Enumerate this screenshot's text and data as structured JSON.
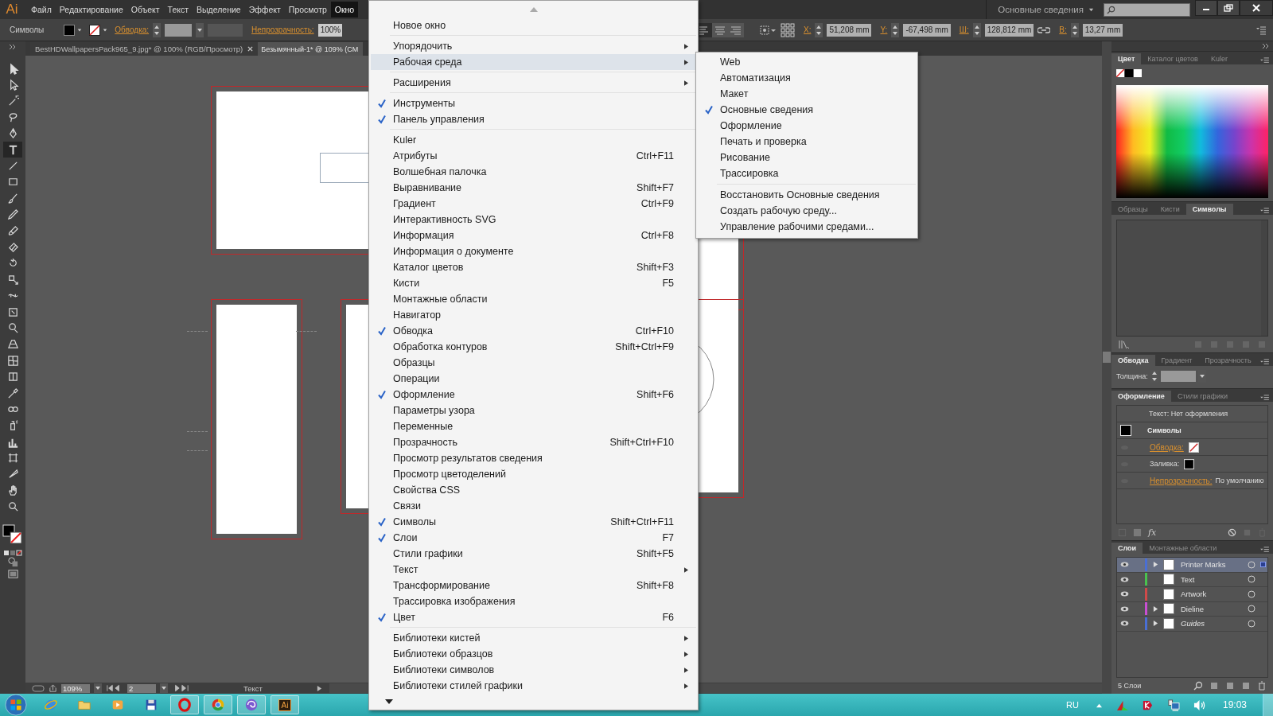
{
  "menubar": {
    "logo": "Ai",
    "items": [
      {
        "label": "Файл",
        "selected": false
      },
      {
        "label": "Редактирование",
        "selected": false
      },
      {
        "label": "Объект",
        "selected": false
      },
      {
        "label": "Текст",
        "selected": false
      },
      {
        "label": "Выделение",
        "selected": false
      },
      {
        "label": "Эффект",
        "selected": false
      },
      {
        "label": "Просмотр",
        "selected": false
      },
      {
        "label": "Окно",
        "selected": true
      }
    ],
    "workspace": "Основные сведения"
  },
  "control_bar": {
    "object": "Символы",
    "stroke_label": "Обводка:",
    "opacity_label": "Непрозрачность:",
    "opacity": "100%",
    "coords": [
      {
        "label": "X:",
        "value": "51,208 mm"
      },
      {
        "label": "Y:",
        "value": "-67,498 mm"
      },
      {
        "label": "Ш:",
        "value": "128,812 mm"
      },
      {
        "label": "В:",
        "value": "13,27 mm"
      }
    ]
  },
  "doc_tabs": [
    {
      "label": "BestHDWallpapersPack965_9.jpg* @ 100% (RGB/Просмотр)",
      "selected": false
    },
    {
      "label": "Безымянный-1* @ 109% (CM",
      "selected": true
    }
  ],
  "tools": [
    {
      "kind": "arrow",
      "selected": false
    },
    {
      "kind": "hollow-arrow",
      "selected": false
    },
    {
      "kind": "wand",
      "selected": false
    },
    {
      "kind": "lasso",
      "selected": false
    },
    {
      "kind": "pen",
      "selected": false
    },
    {
      "kind": "type",
      "selected": true
    },
    {
      "kind": "line",
      "selected": false
    },
    {
      "kind": "rectangle",
      "selected": false
    },
    {
      "kind": "brush",
      "selected": false
    },
    {
      "kind": "pencil",
      "selected": false
    },
    {
      "kind": "blob-brush",
      "selected": false
    },
    {
      "kind": "eraser",
      "selected": false
    },
    {
      "kind": "rotate",
      "selected": false
    },
    {
      "kind": "scale",
      "selected": false
    },
    {
      "kind": "width",
      "selected": false
    },
    {
      "kind": "free-transform",
      "selected": false
    },
    {
      "kind": "shape-builder",
      "selected": false
    },
    {
      "kind": "perspective-grid",
      "selected": false
    },
    {
      "kind": "mesh",
      "selected": false
    },
    {
      "kind": "gradient",
      "selected": false
    },
    {
      "kind": "eyedropper",
      "selected": false
    },
    {
      "kind": "blend",
      "selected": false
    },
    {
      "kind": "sprayer",
      "selected": false
    },
    {
      "kind": "bar-chart",
      "selected": false
    },
    {
      "kind": "artboard",
      "selected": false
    },
    {
      "kind": "knife",
      "selected": false
    },
    {
      "kind": "hand",
      "selected": false
    },
    {
      "kind": "zoom",
      "selected": false
    }
  ],
  "window_menu": {
    "groups": [
      [
        {
          "label": "Новое окно",
          "checked": false,
          "submenu": false,
          "selected": false
        }
      ],
      [
        {
          "label": "Упорядочить",
          "checked": false,
          "submenu": true,
          "selected": false
        },
        {
          "label": "Рабочая среда",
          "checked": false,
          "submenu": true,
          "selected": true
        }
      ],
      [
        {
          "label": "Расширения",
          "checked": false,
          "submenu": true,
          "selected": false
        }
      ],
      [
        {
          "label": "Инструменты",
          "checked": true,
          "submenu": false,
          "selected": false
        },
        {
          "label": "Панель управления",
          "checked": true,
          "submenu": false,
          "selected": false
        }
      ],
      [
        {
          "label": "Kuler",
          "checked": false,
          "submenu": false,
          "selected": false
        },
        {
          "label": "Атрибуты",
          "shortcut": "Ctrl+F11",
          "checked": false,
          "submenu": false,
          "selected": false
        },
        {
          "label": "Волшебная палочка",
          "checked": false,
          "submenu": false,
          "selected": false
        },
        {
          "label": "Выравнивание",
          "shortcut": "Shift+F7",
          "checked": false,
          "submenu": false,
          "selected": false
        },
        {
          "label": "Градиент",
          "shortcut": "Ctrl+F9",
          "checked": false,
          "submenu": false,
          "selected": false
        },
        {
          "label": "Интерактивность SVG",
          "checked": false,
          "submenu": false,
          "selected": false
        },
        {
          "label": "Информация",
          "shortcut": "Ctrl+F8",
          "checked": false,
          "submenu": false,
          "selected": false
        },
        {
          "label": "Информация о документе",
          "checked": false,
          "submenu": false,
          "selected": false
        },
        {
          "label": "Каталог цветов",
          "shortcut": "Shift+F3",
          "checked": false,
          "submenu": false,
          "selected": false
        },
        {
          "label": "Кисти",
          "shortcut": "F5",
          "checked": false,
          "submenu": false,
          "selected": false
        },
        {
          "label": "Монтажные области",
          "checked": false,
          "submenu": false,
          "selected": false
        },
        {
          "label": "Навигатор",
          "checked": false,
          "submenu": false,
          "selected": false
        },
        {
          "label": "Обводка",
          "shortcut": "Ctrl+F10",
          "checked": true,
          "submenu": false,
          "selected": false
        },
        {
          "label": "Обработка контуров",
          "shortcut": "Shift+Ctrl+F9",
          "checked": false,
          "submenu": false,
          "selected": false
        },
        {
          "label": "Образцы",
          "checked": false,
          "submenu": false,
          "selected": false
        },
        {
          "label": "Операции",
          "checked": false,
          "submenu": false,
          "selected": false
        },
        {
          "label": "Оформление",
          "shortcut": "Shift+F6",
          "checked": true,
          "submenu": false,
          "selected": false
        },
        {
          "label": "Параметры узора",
          "checked": false,
          "submenu": false,
          "selected": false
        },
        {
          "label": "Переменные",
          "checked": false,
          "submenu": false,
          "selected": false
        },
        {
          "label": "Прозрачность",
          "shortcut": "Shift+Ctrl+F10",
          "checked": false,
          "submenu": false,
          "selected": false
        },
        {
          "label": "Просмотр результатов сведения",
          "checked": false,
          "submenu": false,
          "selected": false
        },
        {
          "label": "Просмотр цветоделений",
          "checked": false,
          "submenu": false,
          "selected": false
        },
        {
          "label": "Свойства CSS",
          "checked": false,
          "submenu": false,
          "selected": false
        },
        {
          "label": "Связи",
          "checked": false,
          "submenu": false,
          "selected": false
        },
        {
          "label": "Символы",
          "shortcut": "Shift+Ctrl+F11",
          "checked": true,
          "submenu": false,
          "selected": false
        },
        {
          "label": "Слои",
          "shortcut": "F7",
          "checked": true,
          "submenu": false,
          "selected": false
        },
        {
          "label": "Стили графики",
          "shortcut": "Shift+F5",
          "checked": false,
          "submenu": false,
          "selected": false
        },
        {
          "label": "Текст",
          "checked": false,
          "submenu": true,
          "selected": false
        },
        {
          "label": "Трансформирование",
          "shortcut": "Shift+F8",
          "checked": false,
          "submenu": false,
          "selected": false
        },
        {
          "label": "Трассировка изображения",
          "checked": false,
          "submenu": false,
          "selected": false
        },
        {
          "label": "Цвет",
          "shortcut": "F6",
          "checked": true,
          "submenu": false,
          "selected": false
        }
      ],
      [
        {
          "label": "Библиотеки кистей",
          "checked": false,
          "submenu": true,
          "selected": false
        },
        {
          "label": "Библиотеки образцов",
          "checked": false,
          "submenu": true,
          "selected": false
        },
        {
          "label": "Библиотеки символов",
          "checked": false,
          "submenu": true,
          "selected": false
        },
        {
          "label": "Библиотеки стилей графики",
          "checked": false,
          "submenu": true,
          "selected": false
        }
      ]
    ]
  },
  "workspace_menu": {
    "groups": [
      [
        {
          "label": "Web",
          "checked": false
        },
        {
          "label": "Автоматизация",
          "checked": false
        },
        {
          "label": "Макет",
          "checked": false
        },
        {
          "label": "Основные сведения",
          "checked": true
        },
        {
          "label": "Оформление",
          "checked": false
        },
        {
          "label": "Печать и проверка",
          "checked": false
        },
        {
          "label": "Рисование",
          "checked": false
        },
        {
          "label": "Трассировка",
          "checked": false
        }
      ],
      [
        {
          "label": "Восстановить Основные сведения",
          "checked": false
        },
        {
          "label": "Создать рабочую среду...",
          "checked": false
        },
        {
          "label": "Управление рабочими средами...",
          "checked": false
        }
      ]
    ]
  },
  "panels": {
    "color": {
      "tabs": [
        {
          "label": "Цвет",
          "selected": true
        },
        {
          "label": "Каталог цветов",
          "selected": false
        },
        {
          "label": "Kuler",
          "selected": false
        }
      ]
    },
    "symbols": {
      "tabs": [
        {
          "label": "Образцы",
          "selected": false
        },
        {
          "label": "Кисти",
          "selected": false
        },
        {
          "label": "Символы",
          "selected": true
        }
      ]
    },
    "stroke": {
      "tabs": [
        {
          "label": "Обводка",
          "selected": true
        },
        {
          "label": "Градиент",
          "selected": false
        },
        {
          "label": "Прозрачность",
          "selected": false
        }
      ],
      "weight_label": "Толщина:"
    },
    "appearance": {
      "tabs": [
        {
          "label": "Оформление",
          "selected": true
        },
        {
          "label": "Стили графики",
          "selected": false
        }
      ],
      "header": "Текст: Нет оформления",
      "object": "Символы",
      "rows": [
        {
          "label": "Обводка:",
          "kind": "stroke",
          "link": true
        },
        {
          "label": "Заливка:",
          "kind": "fill",
          "link": false
        },
        {
          "label": "Непрозрачность:",
          "kind": "opacity",
          "link": true,
          "value": "По умолчанию"
        }
      ],
      "effects_button": "fx"
    },
    "layers": {
      "tabs": [
        {
          "label": "Слои",
          "selected": true
        },
        {
          "label": "Монтажные области",
          "selected": false
        }
      ],
      "rows": [
        {
          "name": "Printer Marks",
          "color": "#4a6fd4",
          "expandable": true,
          "selected": true,
          "italic": false
        },
        {
          "name": "Text",
          "color": "#49c24f",
          "expandable": false,
          "selected": false,
          "italic": false
        },
        {
          "name": "Artwork",
          "color": "#d04a4a",
          "expandable": false,
          "selected": false,
          "italic": false
        },
        {
          "name": "Dieline",
          "color": "#c94fd2",
          "expandable": true,
          "selected": false,
          "italic": false
        },
        {
          "name": "Guides",
          "color": "#4a6fd4",
          "expandable": true,
          "selected": false,
          "italic": true
        }
      ],
      "count": "5 Слои"
    }
  },
  "status_bar": {
    "zoom": "109%",
    "artboard": "2",
    "tool": "Текст"
  },
  "taskbar": {
    "apps": [
      {
        "kind": "browser",
        "running": false
      },
      {
        "kind": "folder",
        "running": false
      },
      {
        "kind": "media",
        "running": false
      },
      {
        "kind": "floppy",
        "running": false
      },
      {
        "kind": "ring",
        "running": true
      },
      {
        "kind": "tricolor",
        "running": true
      },
      {
        "kind": "swirl",
        "running": true
      },
      {
        "kind": "app",
        "running": true,
        "label": "Ai"
      }
    ],
    "language": "RU",
    "time": "19:03"
  }
}
